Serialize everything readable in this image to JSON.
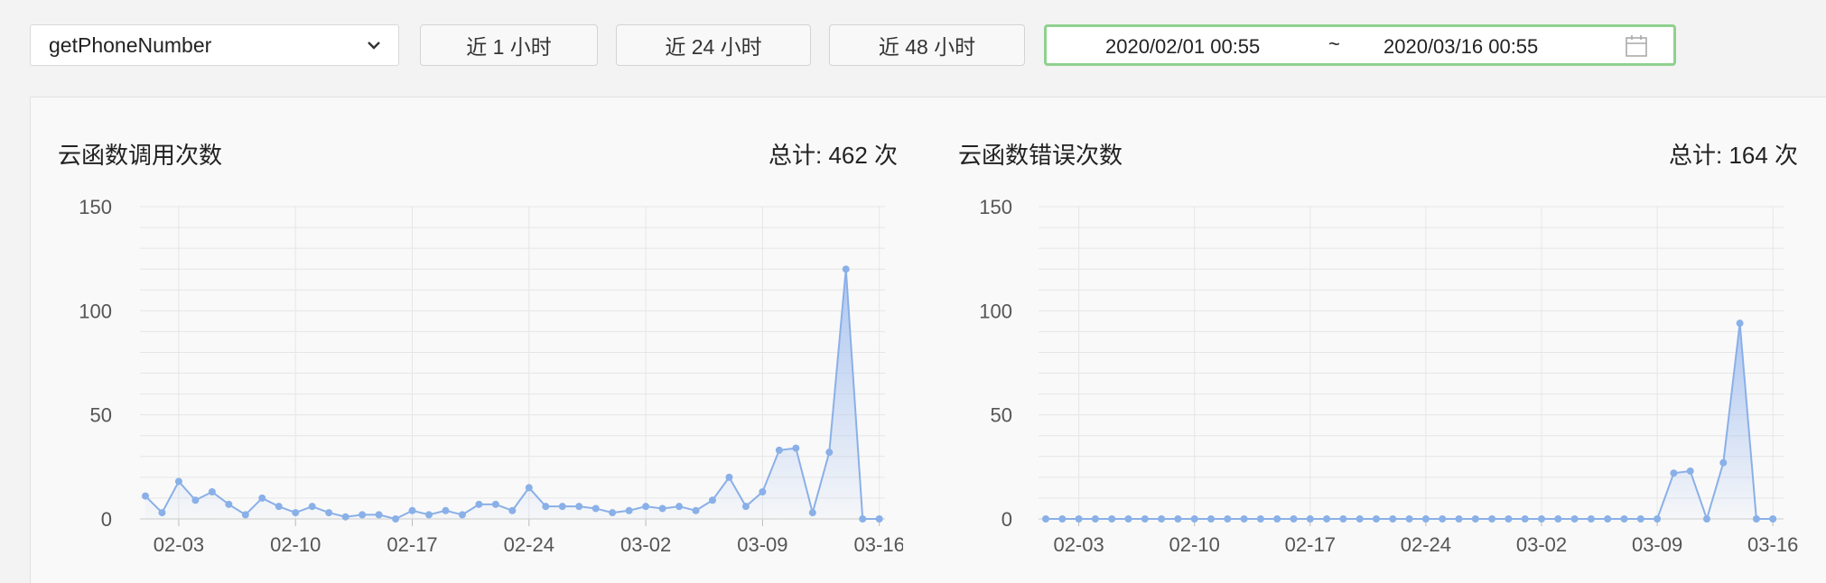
{
  "toolbar": {
    "function_select": {
      "value": "getPhoneNumber"
    },
    "btn_1h": "近 1 小时",
    "btn_24h": "近 24 小时",
    "btn_48h": "近 48 小时",
    "date_range": {
      "from": "2020/02/01 00:55",
      "separator": "~",
      "to": "2020/03/16 00:55"
    }
  },
  "colors": {
    "line": "#8ab0e8",
    "fill_top": "#aac4f0",
    "grid": "#e6e6e6",
    "active_border": "#8fd18f"
  },
  "panels": [
    {
      "title": "云函数调用次数",
      "total": "总计: 462 次"
    },
    {
      "title": "云函数错误次数",
      "total": "总计: 164 次"
    }
  ],
  "chart_data": [
    {
      "type": "area",
      "title": "云函数调用次数",
      "x_start": "2020-02-01",
      "x_tick_labels": [
        "02-03",
        "02-10",
        "02-17",
        "02-24",
        "03-02",
        "03-09",
        "03-16"
      ],
      "ylim": [
        0,
        150
      ],
      "y_ticks": [
        0,
        50,
        100,
        150
      ],
      "grid": true,
      "values": [
        11,
        3,
        18,
        9,
        13,
        7,
        2,
        10,
        6,
        3,
        6,
        3,
        1,
        2,
        2,
        0,
        4,
        2,
        4,
        2,
        7,
        7,
        4,
        15,
        6,
        6,
        6,
        5,
        3,
        4,
        6,
        5,
        6,
        4,
        9,
        20,
        6,
        13,
        33,
        34,
        3,
        32,
        120,
        0,
        0
      ]
    },
    {
      "type": "area",
      "title": "云函数错误次数",
      "x_start": "2020-02-01",
      "x_tick_labels": [
        "02-03",
        "02-10",
        "02-17",
        "02-24",
        "03-02",
        "03-09",
        "03-16"
      ],
      "ylim": [
        0,
        150
      ],
      "y_ticks": [
        0,
        50,
        100,
        150
      ],
      "grid": true,
      "values": [
        0,
        0,
        0,
        0,
        0,
        0,
        0,
        0,
        0,
        0,
        0,
        0,
        0,
        0,
        0,
        0,
        0,
        0,
        0,
        0,
        0,
        0,
        0,
        0,
        0,
        0,
        0,
        0,
        0,
        0,
        0,
        0,
        0,
        0,
        0,
        0,
        0,
        0,
        22,
        23,
        0,
        27,
        94,
        0,
        0
      ]
    }
  ]
}
